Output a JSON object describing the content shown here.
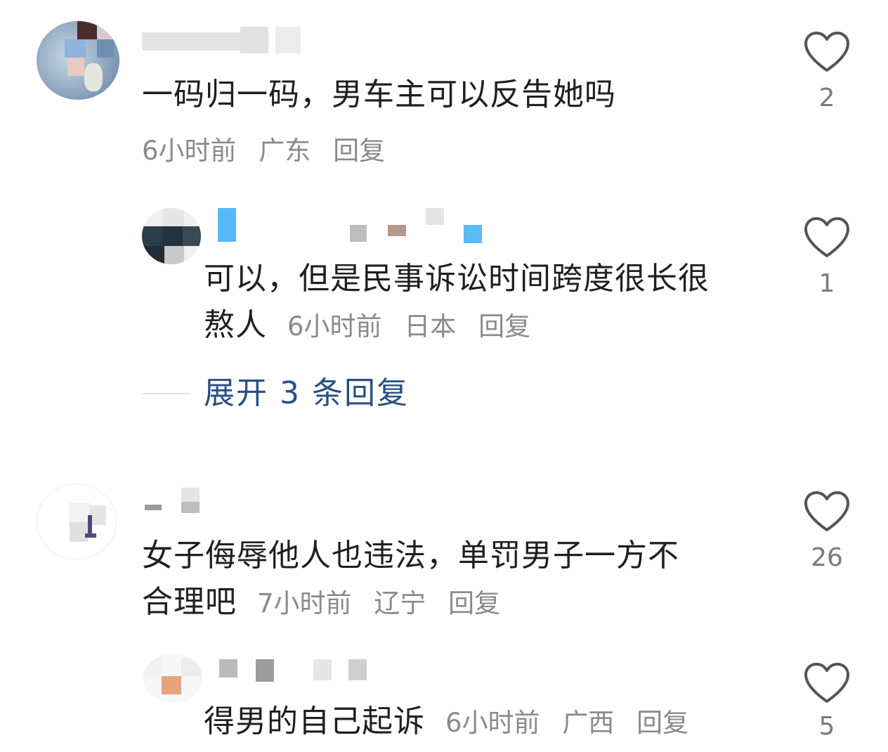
{
  "comments": [
    {
      "text": "一码归一码，男车主可以反告她吗",
      "time": "6小时前",
      "location": "广东",
      "reply": "回复",
      "likes": "2",
      "replies": [
        {
          "text_line1": "可以，但是民事诉讼时间跨度很长很",
          "text_line2": "熬人",
          "time": "6小时前",
          "location": "日本",
          "reply": "回复",
          "likes": "1"
        }
      ],
      "expand_label": "展开 3 条回复"
    },
    {
      "text_line1": "女子侮辱他人也违法，单罚男子一方不",
      "text_line2": "合理吧",
      "time": "7小时前",
      "location": "辽宁",
      "reply": "回复",
      "likes": "26",
      "replies": [
        {
          "text": "得男的自己起诉",
          "time": "6小时前",
          "location": "广西",
          "reply": "回复",
          "likes": "5"
        }
      ]
    }
  ],
  "colors": {
    "text": "#1f1f1f",
    "meta": "#8a8a8a",
    "link": "#2a4f85",
    "heart": "#555555"
  },
  "icons": {
    "like": "heart-outline-icon"
  }
}
